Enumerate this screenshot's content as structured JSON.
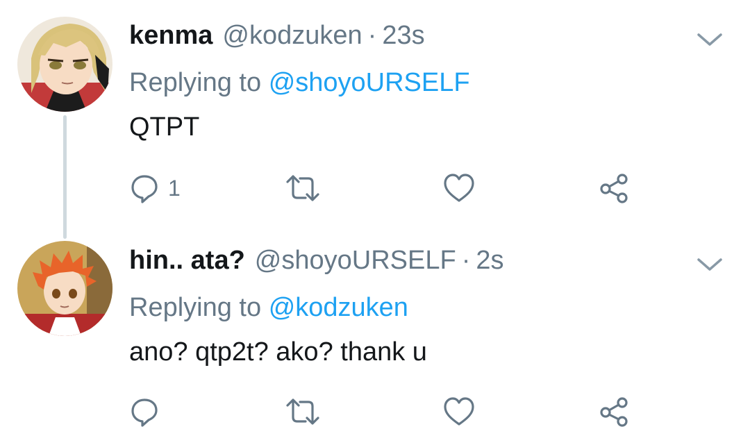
{
  "colors": {
    "text": "#14171a",
    "muted": "#657786",
    "link": "#1da1f2",
    "thread_line": "#cfd9de"
  },
  "tweets": [
    {
      "display_name": "kenma",
      "handle": "@kodzuken",
      "separator": "·",
      "time": "23s",
      "reply_prefix": "Replying to",
      "reply_mention": "@shoyoURSELF",
      "text": "QTPT",
      "reply_count": "1",
      "avatar_icon": "anime-avatar-blonde",
      "icons": [
        "reply-icon",
        "retweet-icon",
        "like-icon",
        "share-icon",
        "chevron-down-icon"
      ]
    },
    {
      "display_name": "hin.. ata?",
      "handle": "@shoyoURSELF",
      "separator": "·",
      "time": "2s",
      "reply_prefix": "Replying to",
      "reply_mention": "@kodzuken",
      "text": "ano? qtp2t? ako? thank u",
      "reply_count": "",
      "avatar_icon": "anime-avatar-orange",
      "icons": [
        "reply-icon",
        "retweet-icon",
        "like-icon",
        "share-icon",
        "chevron-down-icon"
      ]
    }
  ]
}
